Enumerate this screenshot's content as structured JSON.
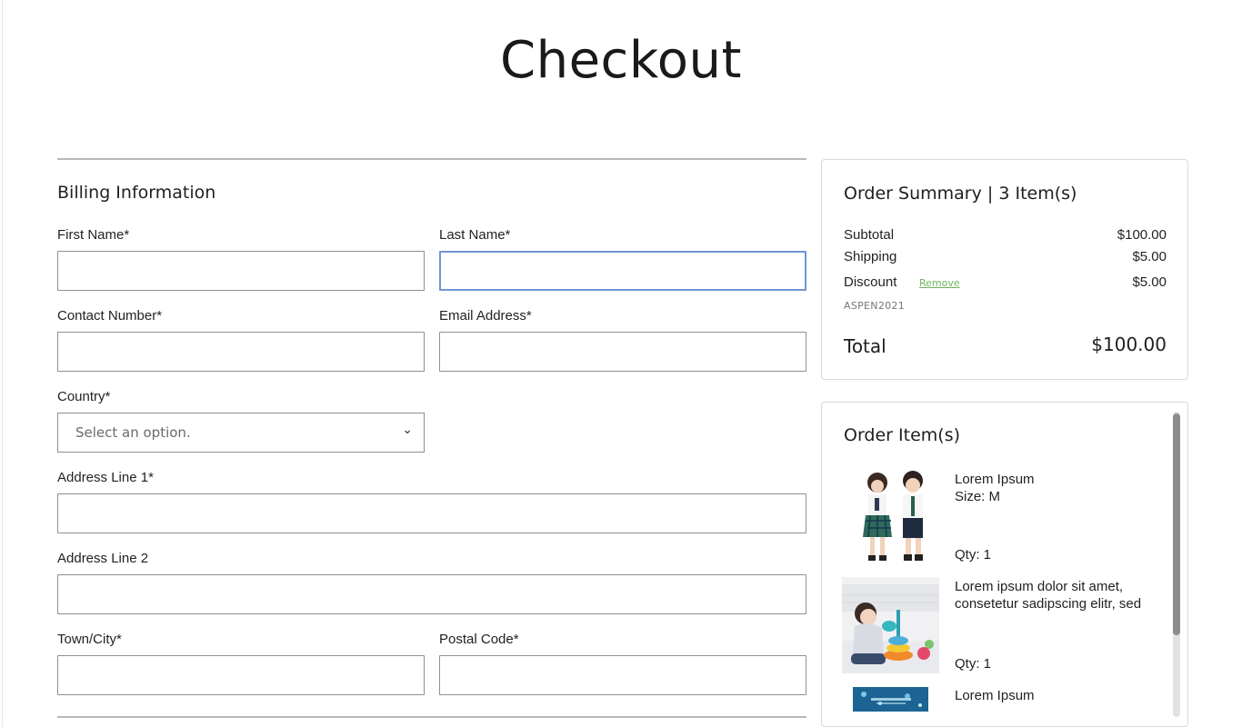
{
  "page": {
    "title": "Checkout"
  },
  "billing": {
    "title": "Billing Information",
    "fields": {
      "first_name": {
        "label": "First Name*",
        "value": "",
        "placeholder": ""
      },
      "last_name": {
        "label": "Last Name*",
        "value": "",
        "placeholder": ""
      },
      "contact_number": {
        "label": "Contact Number*",
        "value": "",
        "placeholder": ""
      },
      "email": {
        "label": "Email Address*",
        "value": "",
        "placeholder": ""
      },
      "country": {
        "label": "Country*",
        "selected": "Select an option."
      },
      "address1": {
        "label": "Address Line 1*",
        "value": "",
        "placeholder": ""
      },
      "address2": {
        "label": "Address Line 2",
        "value": "",
        "placeholder": ""
      },
      "town": {
        "label": "Town/City*",
        "value": "",
        "placeholder": ""
      },
      "postal": {
        "label": "Postal Code*",
        "value": "",
        "placeholder": ""
      }
    }
  },
  "summary": {
    "title": "Order Summary | 3 Item(s)",
    "subtotal_label": "Subtotal",
    "subtotal_value": "$100.00",
    "shipping_label": "Shipping",
    "shipping_value": "$5.00",
    "discount_label": "Discount",
    "remove_label": "Remove",
    "discount_value": "$5.00",
    "coupon_code": "ASPEN2021",
    "total_label": "Total",
    "total_value": "$100.00"
  },
  "order_items": {
    "title": "Order Item(s)",
    "items": [
      {
        "name": "Lorem Ipsum",
        "size": "Size: M",
        "qty": "Qty: 1",
        "image": "children-in-school-uniform-photo"
      },
      {
        "name": "Lorem ipsum dolor sit amet, consetetur sadipscing elitr, sed",
        "qty": "Qty: 1",
        "image": "baby-playing-with-stacking-rings-photo"
      },
      {
        "name": "Lorem Ipsum",
        "image": "blue-illustrated-book-cover"
      }
    ]
  },
  "colors": {
    "focus_border": "#6f95d6",
    "link_green": "#6fb35c",
    "input_border": "#8f8f8f"
  }
}
